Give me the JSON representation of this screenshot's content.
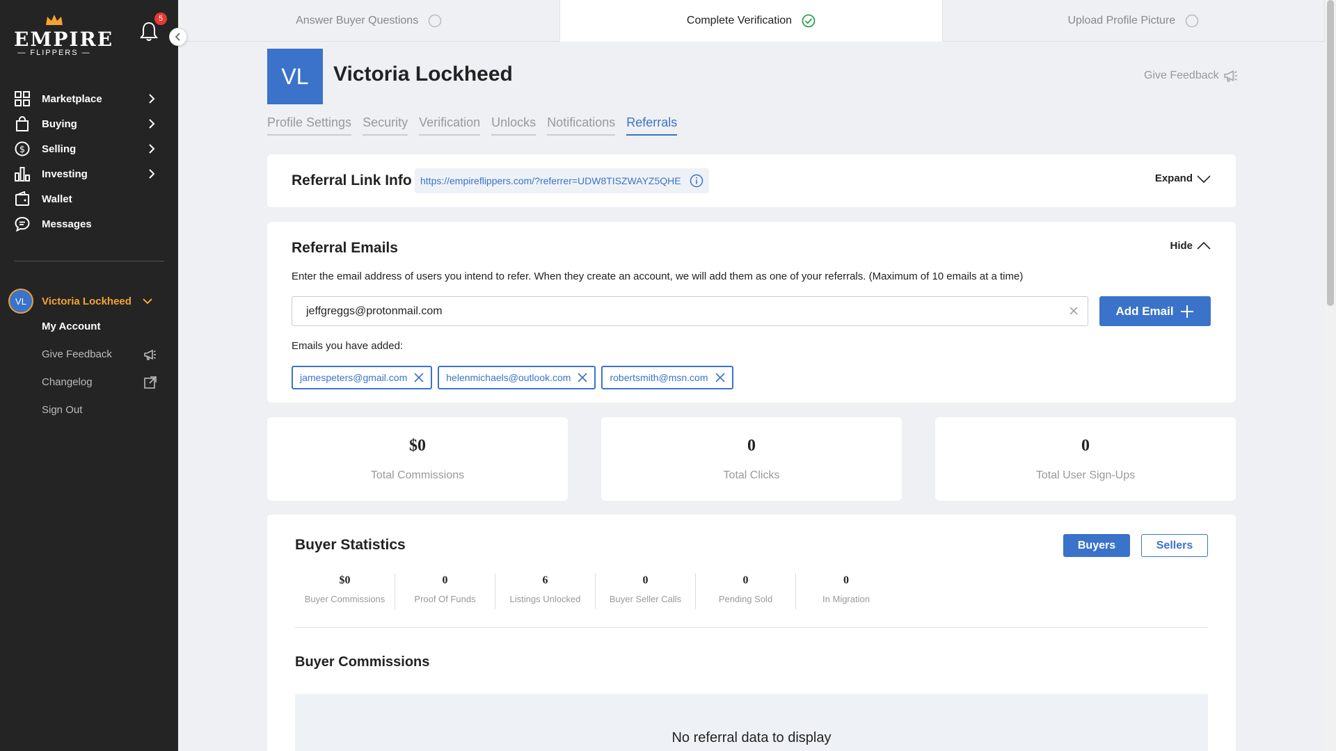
{
  "sidebar": {
    "logo_text": "EMPIRE",
    "logo_sub": "— FLIPPERS —",
    "notification_count": "5",
    "nav": [
      {
        "label": "Marketplace",
        "icon": "grid-icon",
        "has_chevron": true
      },
      {
        "label": "Buying",
        "icon": "shopping-bag-icon",
        "has_chevron": true
      },
      {
        "label": "Selling",
        "icon": "dollar-circle-icon",
        "has_chevron": true
      },
      {
        "label": "Investing",
        "icon": "bar-chart-icon",
        "has_chevron": true
      },
      {
        "label": "Wallet",
        "icon": "wallet-icon",
        "has_chevron": false
      },
      {
        "label": "Messages",
        "icon": "chat-icon",
        "has_chevron": false
      }
    ],
    "user": {
      "initials": "VL",
      "name": "Victoria Lockheed"
    },
    "user_menu": [
      {
        "label": "My Account",
        "active": true
      },
      {
        "label": "Give Feedback",
        "icon": "megaphone-icon"
      },
      {
        "label": "Changelog",
        "icon": "external-link-icon"
      },
      {
        "label": "Sign Out"
      }
    ]
  },
  "steps": [
    {
      "label": "Answer Buyer Questions",
      "done": false
    },
    {
      "label": "Complete Verification",
      "done": true
    },
    {
      "label": "Upload Profile Picture",
      "done": false
    }
  ],
  "profile": {
    "initials": "VL",
    "name": "Victoria Lockheed",
    "feedback_label": "Give Feedback"
  },
  "tabs": [
    {
      "label": "Profile Settings",
      "active": false
    },
    {
      "label": "Security",
      "active": false
    },
    {
      "label": "Verification",
      "active": false
    },
    {
      "label": "Unlocks",
      "active": false
    },
    {
      "label": "Notifications",
      "active": false
    },
    {
      "label": "Referrals",
      "active": true
    }
  ],
  "referral_link": {
    "title": "Referral Link Info",
    "url": "https://empireflippers.com/?referrer=UDW8TISZWAYZ5QHE",
    "expand_label": "Expand"
  },
  "referral_emails": {
    "title": "Referral Emails",
    "hide_label": "Hide",
    "description": "Enter the email address of users you intend to refer. When they create an account, we will add them as one of your referrals. (Maximum of 10 emails at a time)",
    "input_value": "jeffgreggs@protonmail.com",
    "add_label": "Add Email",
    "added_label": "Emails you have added:",
    "emails": [
      "jamespeters@gmail.com",
      "helenmichaels@outlook.com",
      "robertsmith@msn.com"
    ]
  },
  "summary": [
    {
      "value": "$0",
      "label": "Total Commissions"
    },
    {
      "value": "0",
      "label": "Total Clicks"
    },
    {
      "value": "0",
      "label": "Total User Sign-Ups"
    }
  ],
  "buyer_statistics": {
    "title": "Buyer Statistics",
    "toggle_buyers": "Buyers",
    "toggle_sellers": "Sellers",
    "stats": [
      {
        "value": "$0",
        "label": "Buyer Commissions"
      },
      {
        "value": "0",
        "label": "Proof Of Funds"
      },
      {
        "value": "6",
        "label": "Listings Unlocked"
      },
      {
        "value": "0",
        "label": "Buyer Seller Calls"
      },
      {
        "value": "0",
        "label": "Pending Sold"
      },
      {
        "value": "0",
        "label": "In Migration"
      }
    ],
    "commissions_title": "Buyer Commissions",
    "empty_text": "No referral data to display"
  },
  "colors": {
    "sidebar_bg": "#242424",
    "accent_blue": "#3a73c9",
    "accent_orange": "#f7a333",
    "badge_red": "#e53935",
    "success_green": "#2e9e4f"
  }
}
